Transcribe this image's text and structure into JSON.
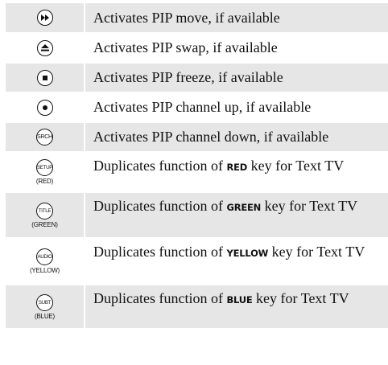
{
  "rows": [
    {
      "icon": "fast-forward-icon",
      "description": "Activates PIP move, if available"
    },
    {
      "icon": "eject-icon",
      "description": "Activates PIP swap, if available"
    },
    {
      "icon": "stop-icon",
      "description": "Activates PIP freeze, if available"
    },
    {
      "icon": "record-icon",
      "description": "Activates PIP channel up, if available"
    },
    {
      "icon": "srch-icon",
      "button_label": "SRCH",
      "description": "Activates PIP channel down, if available"
    },
    {
      "icon": "setup-icon",
      "button_label": "SETUP",
      "caption": "(RED)",
      "desc_pre": "Duplicates function of ",
      "keyword": "RED",
      "desc_post": " key for Text TV"
    },
    {
      "icon": "title-icon",
      "button_label": "TITLE",
      "caption": "(GREEN)",
      "desc_pre": "Duplicates function of ",
      "keyword": "GREEN",
      "desc_post": " key for Text TV"
    },
    {
      "icon": "audio-icon",
      "button_label": "AUDIO",
      "caption": "(YELLOW)",
      "desc_pre": "Duplicates function of ",
      "keyword": "YELLOW",
      "desc_post": " key for Text TV"
    },
    {
      "icon": "subt-icon",
      "button_label": "SUBT",
      "caption": "(BLUE)",
      "desc_pre": "Duplicates function of ",
      "keyword": "BLUE",
      "desc_post": " key for Text TV"
    }
  ],
  "colors": {
    "row_shade": "#e6e6e6",
    "background": "#ffffff",
    "text": "#111111"
  }
}
